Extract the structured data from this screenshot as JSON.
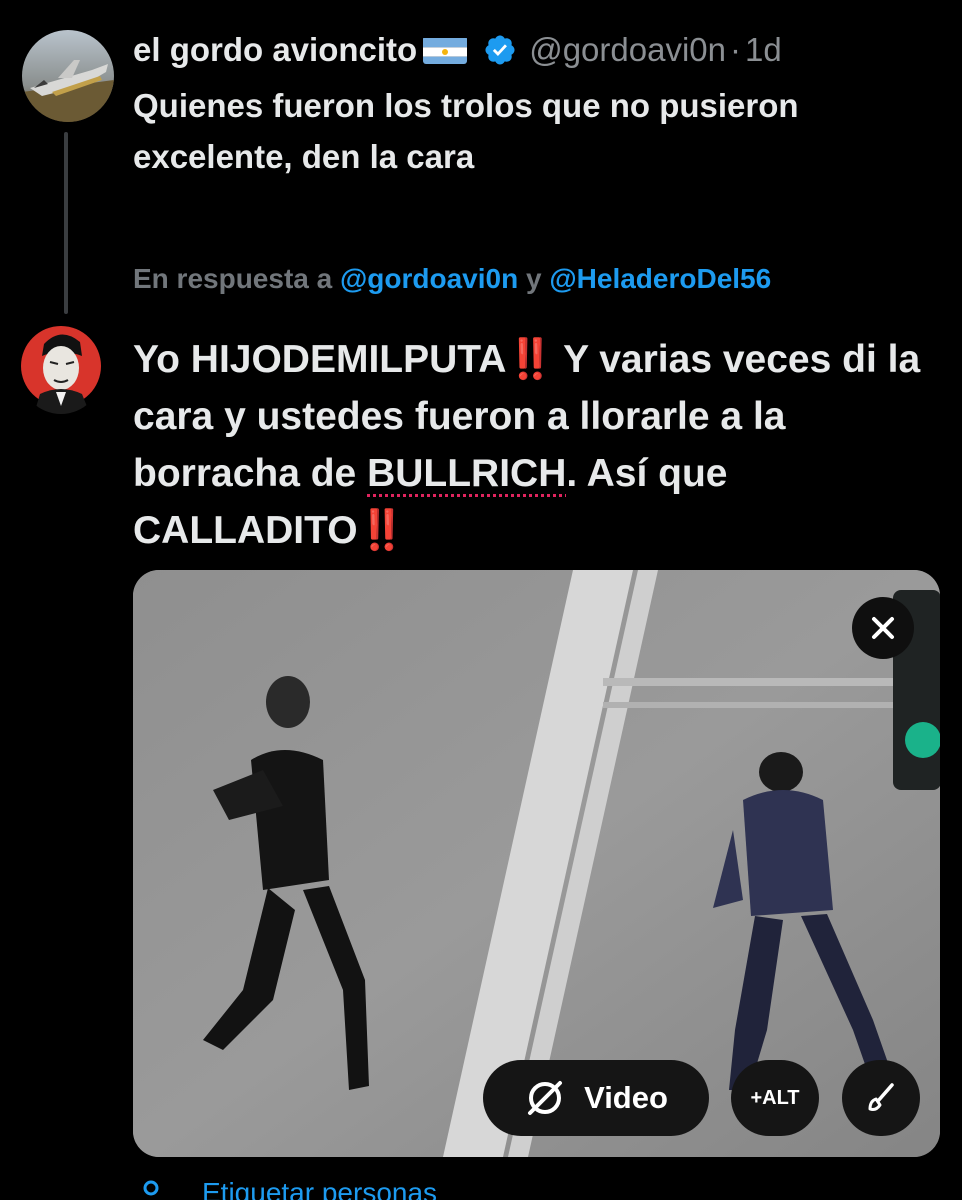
{
  "parent_tweet": {
    "display_name": "el gordo avioncito",
    "handle": "@gordoavi0n",
    "separator": "·",
    "time": "1d",
    "text": "Quienes fueron los trolos que no pusieron excelente, den la cara",
    "avatar_icon": "plane-photo-avatar",
    "flag_icon": "argentina-flag-icon",
    "badge_icon": "verified-badge-icon"
  },
  "reply": {
    "reply_prefix": "En respuesta a",
    "mention_1": "@gordoavi0n",
    "conjunction": "y",
    "mention_2": "@HeladeroDel56",
    "avatar_icon": "portrait-illustration-avatar",
    "text_parts": {
      "p1": "Yo HIJODEMILPUTA",
      "bang": "‼️",
      "p2": " Y varias veces di la cara y ustedes fueron a llorarle a la borracha de ",
      "misspelled": "BULLRICH",
      "p3": ". Así que CALLADITO"
    }
  },
  "media": {
    "close_icon": "close-icon",
    "video_label": "Video",
    "alt_label": "+ALT",
    "edit_icon": "paintbrush-icon",
    "video_icon": "video-slash-icon"
  },
  "composer": {
    "tag_people_label": "Etiquetar personas",
    "tag_icon": "person-icon"
  },
  "colors": {
    "background": "#000000",
    "text": "#e7e9ea",
    "muted": "#71767b",
    "accent": "#1d9bf0",
    "exclamation": "#e8271d"
  }
}
